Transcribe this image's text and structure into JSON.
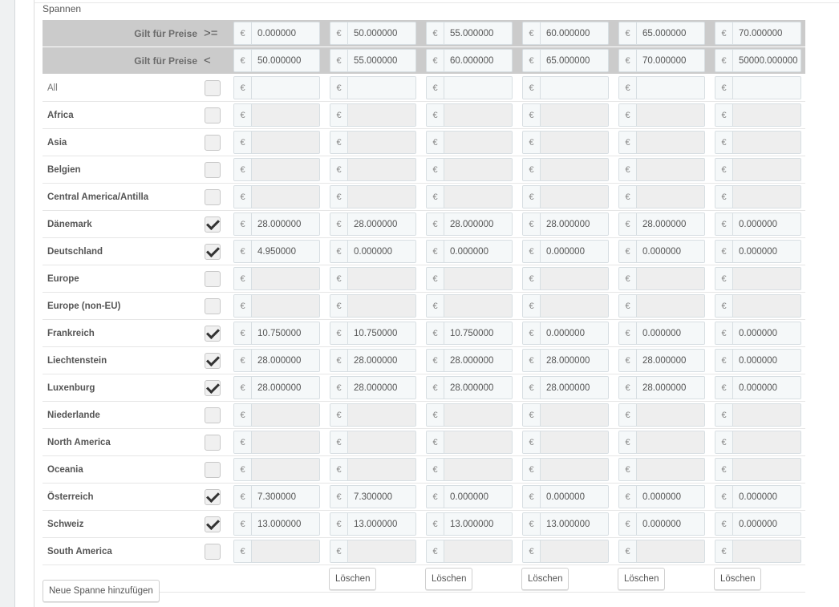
{
  "section_title": "Spannen",
  "header_rows": [
    {
      "label": "Gilt für Preise",
      "operator": ">=",
      "values": [
        "0.000000",
        "50.000000",
        "55.000000",
        "60.000000",
        "65.000000",
        "70.000000"
      ]
    },
    {
      "label": "Gilt für Preise",
      "operator": "<",
      "values": [
        "50.000000",
        "55.000000",
        "60.000000",
        "65.000000",
        "70.000000",
        "50000.000000"
      ]
    }
  ],
  "currency_symbol": "€",
  "zones": [
    {
      "name": "All",
      "checked": false,
      "values": [
        "",
        "",
        "",
        "",
        "",
        ""
      ]
    },
    {
      "name": "Africa",
      "checked": false,
      "values": [
        "",
        "",
        "",
        "",
        "",
        ""
      ]
    },
    {
      "name": "Asia",
      "checked": false,
      "values": [
        "",
        "",
        "",
        "",
        "",
        ""
      ]
    },
    {
      "name": "Belgien",
      "checked": false,
      "values": [
        "",
        "",
        "",
        "",
        "",
        ""
      ]
    },
    {
      "name": "Central America/Antilla",
      "checked": false,
      "values": [
        "",
        "",
        "",
        "",
        "",
        ""
      ]
    },
    {
      "name": "Dänemark",
      "checked": true,
      "values": [
        "28.000000",
        "28.000000",
        "28.000000",
        "28.000000",
        "28.000000",
        "0.000000"
      ]
    },
    {
      "name": "Deutschland",
      "checked": true,
      "values": [
        "4.950000",
        "0.000000",
        "0.000000",
        "0.000000",
        "0.000000",
        "0.000000"
      ]
    },
    {
      "name": "Europe",
      "checked": false,
      "values": [
        "",
        "",
        "",
        "",
        "",
        ""
      ]
    },
    {
      "name": "Europe (non-EU)",
      "checked": false,
      "values": [
        "",
        "",
        "",
        "",
        "",
        ""
      ]
    },
    {
      "name": "Frankreich",
      "checked": true,
      "values": [
        "10.750000",
        "10.750000",
        "10.750000",
        "0.000000",
        "0.000000",
        "0.000000"
      ]
    },
    {
      "name": "Liechtenstein",
      "checked": true,
      "values": [
        "28.000000",
        "28.000000",
        "28.000000",
        "28.000000",
        "28.000000",
        "0.000000"
      ]
    },
    {
      "name": "Luxenburg",
      "checked": true,
      "values": [
        "28.000000",
        "28.000000",
        "28.000000",
        "28.000000",
        "28.000000",
        "0.000000"
      ]
    },
    {
      "name": "Niederlande",
      "checked": false,
      "values": [
        "",
        "",
        "",
        "",
        "",
        ""
      ]
    },
    {
      "name": "North America",
      "checked": false,
      "values": [
        "",
        "",
        "",
        "",
        "",
        ""
      ]
    },
    {
      "name": "Oceania",
      "checked": false,
      "values": [
        "",
        "",
        "",
        "",
        "",
        ""
      ]
    },
    {
      "name": "Österreich",
      "checked": true,
      "values": [
        "7.300000",
        "7.300000",
        "0.000000",
        "0.000000",
        "0.000000",
        "0.000000"
      ]
    },
    {
      "name": "Schweiz",
      "checked": true,
      "values": [
        "13.000000",
        "13.000000",
        "13.000000",
        "13.000000",
        "0.000000",
        "0.000000"
      ]
    },
    {
      "name": "South America",
      "checked": false,
      "values": [
        "",
        "",
        "",
        "",
        "",
        ""
      ]
    }
  ],
  "delete_label": "Löschen",
  "add_range_label": "Neue Spanne hinzufügen"
}
